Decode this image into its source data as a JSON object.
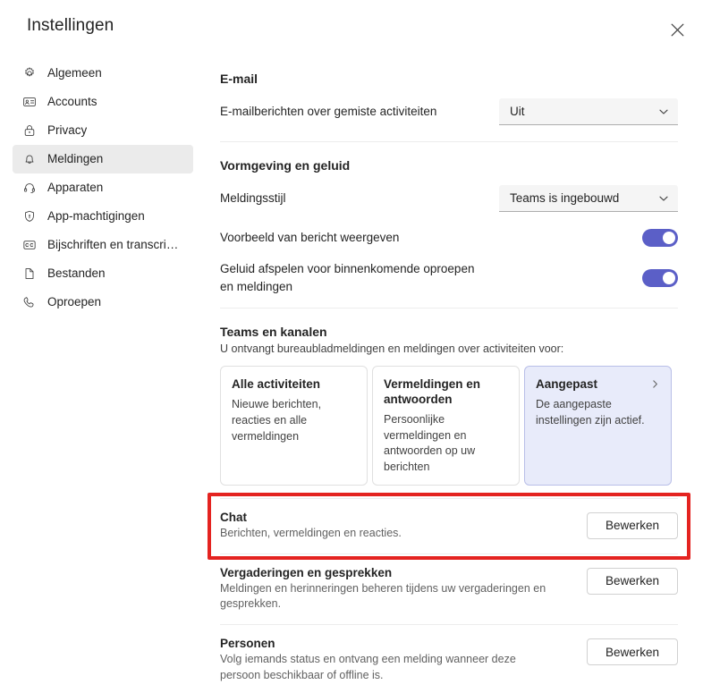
{
  "window": {
    "title": "Instellingen",
    "close_label": "Sluiten"
  },
  "colors": {
    "accent": "#5b5fc7",
    "selected_card_bg": "#e8ebfa",
    "selected_card_border": "#b9bfe8",
    "selected_nav_bg": "#ebebeb",
    "annotation_red": "#e42320",
    "dropdown_bg": "#f5f5f5",
    "text_primary": "#242424",
    "text_secondary": "#616161"
  },
  "sidebar": {
    "items": [
      {
        "label": "Algemeen",
        "icon": "gear-icon",
        "selected": false
      },
      {
        "label": "Accounts",
        "icon": "contact-card-icon",
        "selected": false
      },
      {
        "label": "Privacy",
        "icon": "lock-icon",
        "selected": false
      },
      {
        "label": "Meldingen",
        "icon": "bell-icon",
        "selected": true
      },
      {
        "label": "Apparaten",
        "icon": "headset-icon",
        "selected": false
      },
      {
        "label": "App-machtigingen",
        "icon": "shield-icon",
        "selected": false
      },
      {
        "label": "Bijschriften en transcript...",
        "icon": "closed-caption-icon",
        "selected": false
      },
      {
        "label": "Bestanden",
        "icon": "document-icon",
        "selected": false
      },
      {
        "label": "Oproepen",
        "icon": "phone-icon",
        "selected": false
      }
    ]
  },
  "main": {
    "email_section": {
      "title": "E-mail",
      "row_label": "E-mailberichten over gemiste activiteiten",
      "dropdown_value": "Uit",
      "dropdown_icon": "chevron-down-icon"
    },
    "appearance_section": {
      "title": "Vormgeving en geluid",
      "style_label": "Meldingsstijl",
      "style_value": "Teams is ingebouwd",
      "style_icon": "chevron-down-icon",
      "preview_label": "Voorbeeld van bericht weergeven",
      "preview_on": true,
      "sound_label": "Geluid afspelen voor binnenkomende oproepen en meldingen",
      "sound_on": true
    },
    "teams_section": {
      "title": "Teams en kanalen",
      "subtitle": "U ontvangt bureaubladmeldingen en meldingen over activiteiten voor:",
      "cards": [
        {
          "title": "Alle activiteiten",
          "desc": "Nieuwe berichten, reacties en alle vermeldingen",
          "selected": false,
          "chevron": false
        },
        {
          "title": "Vermeldingen en antwoorden",
          "desc": "Persoonlijke vermeldingen en antwoorden op uw berichten",
          "selected": false,
          "chevron": false
        },
        {
          "title": "Aangepast",
          "desc": "De aangepaste instellingen zijn actief.",
          "selected": true,
          "chevron": true,
          "chevron_icon": "chevron-right-icon"
        }
      ]
    },
    "detail_sections": [
      {
        "title": "Chat",
        "desc": "Berichten, vermeldingen en reacties.",
        "button": "Bewerken",
        "highlighted": true
      },
      {
        "title": "Vergaderingen en gesprekken",
        "desc": "Meldingen en herinneringen beheren tijdens uw vergaderingen en gesprekken.",
        "button": "Bewerken",
        "highlighted": false
      },
      {
        "title": "Personen",
        "desc": "Volg iemands status en ontvang een melding wanneer deze persoon beschikbaar of offline is.",
        "button": "Bewerken",
        "highlighted": false
      }
    ]
  }
}
